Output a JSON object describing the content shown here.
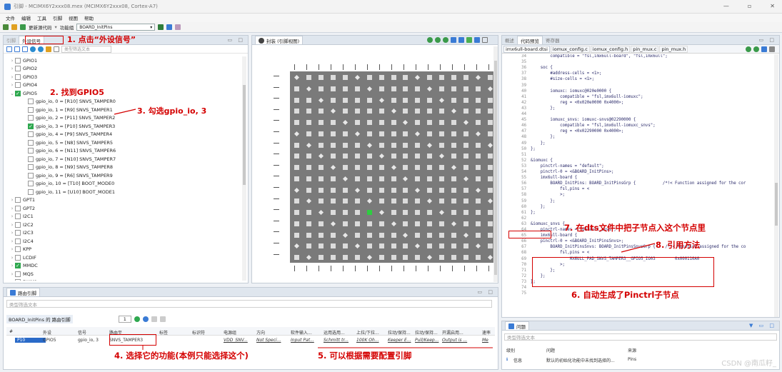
{
  "window": {
    "title": "引脚 - MCIMX6Y2xxx08.mex (MCIMX6Y2xxx08, Cortex-A7)",
    "controls": [
      "—",
      "▫",
      "✕"
    ]
  },
  "menu": [
    "文件",
    "编辑",
    "工具",
    "引脚",
    "视图",
    "帮助"
  ],
  "toolbar": {
    "update_code": "更新源代码",
    "func_group_label": "功能组",
    "func_group_value": "BOARD_InitPins"
  },
  "left_panel": {
    "tabs": [
      "引脚",
      "外设信号"
    ],
    "filter_placeholder": "类型筛选文本",
    "tree": [
      {
        "label": "GPIO1",
        "checked": false,
        "open": false,
        "indent": 0
      },
      {
        "label": "GPIO2",
        "checked": false,
        "open": false,
        "indent": 0
      },
      {
        "label": "GPIO3",
        "checked": false,
        "open": false,
        "indent": 0
      },
      {
        "label": "GPIO4",
        "checked": false,
        "open": false,
        "indent": 0
      },
      {
        "label": "GPIO5",
        "checked": true,
        "open": true,
        "indent": 0
      },
      {
        "label": "gpio_io, 0 = [R10] SNVS_TAMPER0",
        "checked": false,
        "indent": 1
      },
      {
        "label": "gpio_io, 1 = [R9] SNVS_TAMPER1",
        "checked": false,
        "indent": 1
      },
      {
        "label": "gpio_io, 2 = [P11] SNVS_TAMPER2",
        "checked": false,
        "indent": 1
      },
      {
        "label": "gpio_io, 3 = [P10] SNVS_TAMPER3",
        "checked": true,
        "indent": 1
      },
      {
        "label": "gpio_io, 4 = [P9] SNVS_TAMPER4",
        "checked": false,
        "indent": 1
      },
      {
        "label": "gpio_io, 5 = [N8] SNVS_TAMPER5",
        "checked": false,
        "indent": 1
      },
      {
        "label": "gpio_io, 6 = [N11] SNVS_TAMPER6",
        "checked": false,
        "indent": 1
      },
      {
        "label": "gpio_io, 7 = [N10] SNVS_TAMPER7",
        "checked": false,
        "indent": 1
      },
      {
        "label": "gpio_io, 8 = [N9] SNVS_TAMPER8",
        "checked": false,
        "indent": 1
      },
      {
        "label": "gpio_io, 9 = [R6] SNVS_TAMPER9",
        "checked": false,
        "indent": 1
      },
      {
        "label": "gpio_io, 10 = [T10] BOOT_MODE0",
        "checked": false,
        "indent": 1
      },
      {
        "label": "gpio_io, 11 = [U10] BOOT_MODE1",
        "checked": false,
        "indent": 1
      },
      {
        "label": "GPT1",
        "checked": false,
        "open": false,
        "indent": 0
      },
      {
        "label": "GPT2",
        "checked": false,
        "open": false,
        "indent": 0
      },
      {
        "label": "I2C1",
        "checked": false,
        "open": false,
        "indent": 0
      },
      {
        "label": "I2C2",
        "checked": false,
        "open": false,
        "indent": 0
      },
      {
        "label": "I2C3",
        "checked": false,
        "open": false,
        "indent": 0
      },
      {
        "label": "I2C4",
        "checked": false,
        "open": false,
        "indent": 0
      },
      {
        "label": "KPP",
        "checked": false,
        "open": false,
        "indent": 0
      },
      {
        "label": "LCDIF",
        "checked": false,
        "open": false,
        "indent": 0
      },
      {
        "label": "MMDC",
        "checked": true,
        "open": false,
        "indent": 0
      },
      {
        "label": "MQS",
        "checked": false,
        "open": false,
        "indent": 0
      },
      {
        "label": "PWM1",
        "checked": false,
        "open": false,
        "indent": 0
      }
    ]
  },
  "pkg_panel": {
    "tab": "封装 (引脚视图)"
  },
  "right_panel": {
    "tabs": [
      "概述",
      "代码预览",
      "寄存器"
    ],
    "file_tabs": [
      "imx6ull-board.dtsi",
      "iomux_config.c",
      "iomux_config.h",
      "pin_mux.c",
      "pin_mux.h"
    ],
    "code": [
      {
        "n": "34",
        "t": "        compatible = \"fsl,imx6ull-board\", \"fsl,imx6ull\";"
      },
      {
        "n": "35",
        "t": ""
      },
      {
        "n": "36",
        "t": "    soc {"
      },
      {
        "n": "37",
        "t": "        #address-cells = <1>;"
      },
      {
        "n": "38",
        "t": "        #size-cells = <1>;"
      },
      {
        "n": "39",
        "t": ""
      },
      {
        "n": "40",
        "t": "        iomuxc: iomuxc@020e0000 {"
      },
      {
        "n": "41",
        "t": "            compatible = \"fsl,imx6ull-iomuxc\";"
      },
      {
        "n": "42",
        "t": "            reg = <0x020e0000 0x4000>;"
      },
      {
        "n": "43",
        "t": "        };"
      },
      {
        "n": "44",
        "t": ""
      },
      {
        "n": "45",
        "t": "        iomuxc_snvs: iomuxc-snvs@02290000 {"
      },
      {
        "n": "46",
        "t": "            compatible = \"fsl,imx6ull-iomuxc_snvs\";"
      },
      {
        "n": "47",
        "t": "            reg = <0x02290000 0x4000>;"
      },
      {
        "n": "48",
        "t": "        };"
      },
      {
        "n": "49",
        "t": "    };"
      },
      {
        "n": "50",
        "t": "};"
      },
      {
        "n": "51",
        "t": ""
      },
      {
        "n": "52",
        "t": "&iomuxc {"
      },
      {
        "n": "53",
        "t": "    pinctrl-names = \"default\";"
      },
      {
        "n": "54",
        "t": "    pinctrl-0 = <&BOARD_InitPins>;"
      },
      {
        "n": "55",
        "t": "    imx6ull-board {"
      },
      {
        "n": "56",
        "t": "        BOARD_InitPins: BOARD_InitPinsGrp {           /*!< Function assigned for the cor"
      },
      {
        "n": "57",
        "t": "            fsl,pins = <"
      },
      {
        "n": "58",
        "t": "            >;"
      },
      {
        "n": "59",
        "t": "        };"
      },
      {
        "n": "60",
        "t": "    };"
      },
      {
        "n": "61",
        "t": "};"
      },
      {
        "n": "62",
        "t": ""
      },
      {
        "n": "63",
        "t": "&iomuxc_snvs {"
      },
      {
        "n": "64",
        "t": "    pinctrl-names = \"default_snvs\";"
      },
      {
        "n": "65",
        "t": "    imx6ull-board {"
      },
      {
        "n": "66",
        "t": "    pinctrl-0 = <&BOARD_InitPinsSnvs>;"
      },
      {
        "n": "67",
        "t": "        BOARD_InitPinsSnvs: BOARD_InitPinsSnvsGrp {    /*!< Function assigned for the co"
      },
      {
        "n": "68",
        "t": "            fsl,pins = <"
      },
      {
        "n": "69",
        "t": "                MX6ULL_PAD_SNVS_TAMPER3__GPIO5_IO03        0x000110A0"
      },
      {
        "n": "70",
        "t": "            >;"
      },
      {
        "n": "71",
        "t": "        };"
      },
      {
        "n": "72",
        "t": "    };"
      },
      {
        "n": "73",
        "t": "};"
      },
      {
        "n": "74",
        "t": ""
      },
      {
        "n": "75",
        "t": ""
      }
    ]
  },
  "routing_panel": {
    "tab": "路由引脚",
    "filter_placeholder": "类型筛选文本",
    "group_label": "BOARD_InitPins 的 路由引脚",
    "count": "1",
    "headers": [
      "#",
      "外设",
      "信号",
      "路由至",
      "标签",
      "标识符",
      "电源组",
      "方向",
      "软件输入...",
      "运用选用...",
      "上拉/下拉...",
      "拉动/保持...",
      "拉动/保持...",
      "开漏启用...",
      "速率"
    ],
    "row": [
      "P10",
      "GPIO5",
      "gpio_io, 3",
      "SNVS_TAMPER3",
      "",
      "",
      "VDD_SNV...",
      "Not Speci...",
      "Input Pat...",
      "Schmitt tr...",
      "100K Oh...",
      "Keeper E...",
      "Pull/Keep...",
      "Output is ...",
      "Me"
    ]
  },
  "problems_panel": {
    "tab": "问题",
    "filter_placeholder": "类型筛选文本",
    "headers": [
      "级别",
      "问题",
      "来源"
    ],
    "row": {
      "level": "信息",
      "issue": "默认的初始化功能中未找到选择的...",
      "source": "Pins"
    }
  },
  "annotations": {
    "a1": "1. 点击“外设信号”",
    "a2": "2. 找到GPIO5",
    "a3": "3. 勾选gpio_io, 3",
    "a4": "4. 选择它的功能(本例只能选择这个)",
    "a5": "5. 可以根据需要配置引脚",
    "a6": "6. 自动生成了Pinctrl子节点",
    "a7": "7. 在dts文件中把子节点入这个节点里",
    "a8": "8. 引用方法"
  },
  "watermark": "CSDN @南瓜籽_",
  "colors": {
    "annotation": "#d40000",
    "accent": "#3a7bd5",
    "pin_green": "#2ecc40"
  }
}
